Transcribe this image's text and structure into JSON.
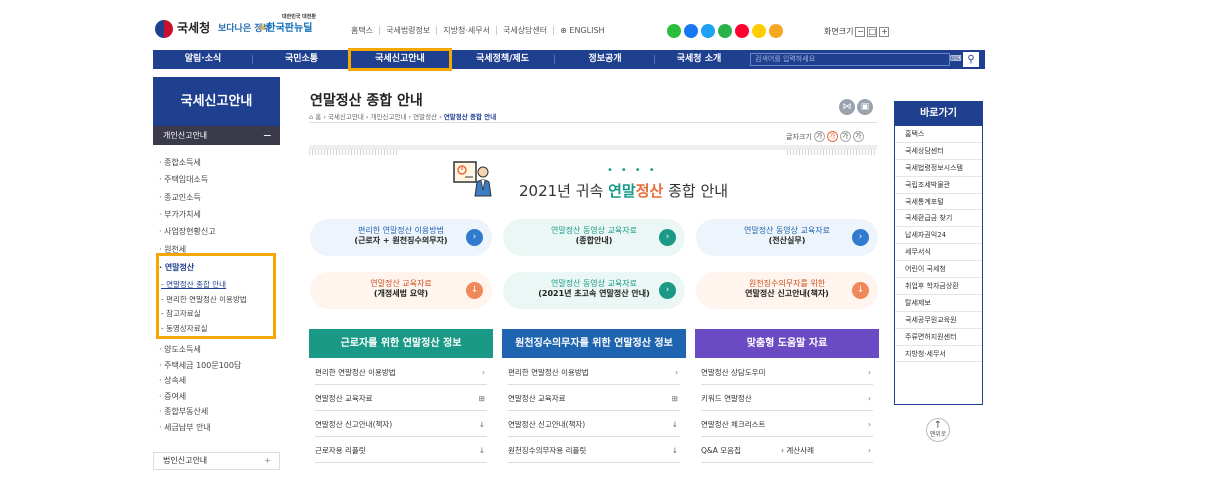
{
  "header": {
    "site_name": "국세청",
    "gov_slogan": "보다나은 정부",
    "new_deal": "한국판뉴딜",
    "new_deal_small": "대한민국 대전환",
    "util_links": [
      "홈택스",
      "국세법령정보",
      "지방청·세무서",
      "국세상담센터",
      "⊕ ENGLISH"
    ],
    "sns_colors": [
      "#2bbd3b",
      "#1877f2",
      "#1da1f2",
      "#2ab24a",
      "#ff0033",
      "#ffcd00",
      "#f5a623"
    ],
    "font_size_label": "화면크기",
    "font_btns": [
      "−",
      "□",
      "+"
    ]
  },
  "gnb": {
    "items": [
      "알림·소식",
      "국민소통",
      "국세신고안내",
      "국세정책/제도",
      "정보공개",
      "국세청 소개"
    ],
    "search_placeholder": "검색어를 입력하세요",
    "search_icon": "search-icon"
  },
  "lnb": {
    "title": "국세신고안내",
    "section": "개인신고안내",
    "section_icon": "−",
    "items": [
      "· 종합소득세",
      "· 주택임대소득",
      "· 종교인소득",
      "· 부가가치세",
      "· 사업장현황신고",
      "· 원천세",
      "· 연말정산"
    ],
    "sub_items": [
      "- 연말정산 종합 안내",
      "- 편리한 연말정산 이용방법",
      "- 참고자료실",
      "- 동영상자료실"
    ],
    "items2": [
      "· 양도소득세",
      "· 주택세금 100문100답",
      "· 상속세",
      "· 증여세",
      "· 종합부동산세",
      "· 세금납부 안내"
    ],
    "bottom": "법인신고안내",
    "bottom_icon": "+"
  },
  "main": {
    "title": "연말정산 종합 안내",
    "breadcrumb": [
      "⌂ 홈",
      "국세신고안내",
      "개인신고안내",
      "연말정산"
    ],
    "breadcrumb_current": "연말정산 종합 안내",
    "fontsize_label": "글자크기",
    "fontsize_btns": [
      "가",
      "가",
      "가",
      "가"
    ],
    "banner": {
      "pre": "2021년 귀속 ",
      "g": "연말",
      "o": "정산",
      "post": " 종합 안내",
      "dots": "••••"
    },
    "pills": [
      {
        "t": "편리한 연말정산 이용방법",
        "b": "(근로자 + 원천징수의무자)",
        "style": "blue",
        "icon": "›"
      },
      {
        "t": "연말정산 동영상 교육자료",
        "b": "(종합안내)",
        "style": "grn",
        "icon": "›"
      },
      {
        "t": "연말정산 동영상 교육자료",
        "b": "(전산실무)",
        "style": "blue",
        "icon": "›"
      },
      {
        "t": "연말정산 교육자료",
        "b": "(개정세법 요약)",
        "style": "org",
        "icon": "↓"
      },
      {
        "t": "연말정산 동영상 교육자료",
        "b": "(2021년 초고속 연말정산 안내)",
        "style": "grn",
        "icon": "›"
      },
      {
        "t": "원천징수의무자를 위한",
        "b": "연말정산 신고안내(책자)",
        "style": "org",
        "icon": "↓"
      }
    ],
    "columns": [
      {
        "title": "근로자를 위한 연말정산 정보",
        "color": "#1a9a86",
        "rows": [
          [
            "편리한 연말정산 이용방법",
            "›"
          ],
          [
            "연말정산 교육자료",
            "⊞"
          ],
          [
            "연말정산 신고안내(책자)",
            "↓"
          ],
          [
            "근로자용 리플릿",
            "↓"
          ]
        ]
      },
      {
        "title": "원천징수의무자를 위한 연말정산 정보",
        "color": "#1f64b0",
        "rows": [
          [
            "편리한 연말정산 이용방법",
            "›"
          ],
          [
            "연말정산 교육자료",
            "⊞"
          ],
          [
            "연말정산 신고안내(책자)",
            "↓"
          ],
          [
            "원천징수의무자용 리플릿",
            "↓"
          ]
        ]
      },
      {
        "title": "맞춤형 도움말 자료",
        "color": "#6a4bc4",
        "rows": [
          [
            "연말정산 상담도우미",
            "›"
          ],
          [
            "키워드 연말정산",
            "›"
          ],
          [
            "연말정산 체크리스트",
            "›"
          ],
          [
            "Q&A 모음집",
            "›"
          ]
        ]
      }
    ],
    "col3_extra": "› 계산사례"
  },
  "quick": {
    "title": "바로가기",
    "items": [
      "홈택스",
      "국세상담센터",
      "국세법령정보시스템",
      "국립조세박물관",
      "국세통계포털",
      "국세환급금 찾기",
      "납세자권익24",
      "세무서식",
      "어린이 국세청",
      "취업후 학자금상환",
      "탈세제보",
      "국세공무원교육원",
      "주류면허지원센터",
      "지방청·세무서"
    ]
  },
  "top_btn": {
    "arrow": "↑",
    "label": "맨위로"
  }
}
